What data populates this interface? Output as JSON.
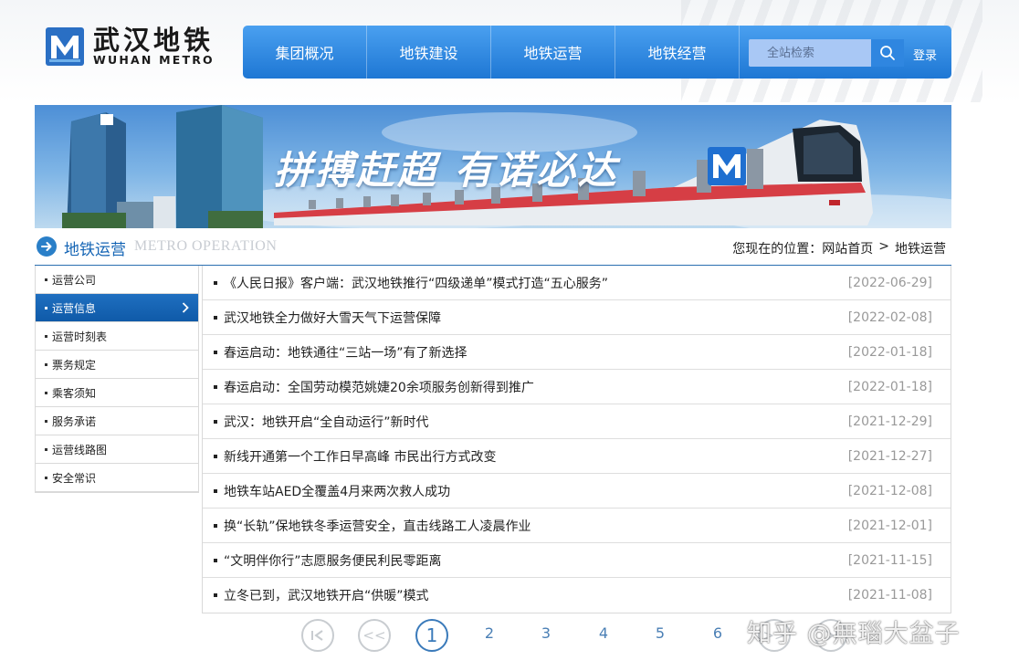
{
  "header": {
    "logo_cn": "武汉地铁",
    "logo_en": "WUHAN METRO",
    "nav": [
      "集团概况",
      "地铁建设",
      "地铁运营",
      "地铁经营"
    ],
    "search_placeholder": "全站检索",
    "login_label": "登录"
  },
  "banner": {
    "slogan": "拼搏赶超  有诺必达"
  },
  "section": {
    "title": "地铁运营",
    "subtitle": "METRO OPERATION",
    "breadcrumb_prefix": "您现在的位置：",
    "breadcrumb_home": "网站首页",
    "breadcrumb_sep": ">",
    "breadcrumb_current": "地铁运营"
  },
  "sidebar": {
    "items": [
      {
        "label": "运营公司"
      },
      {
        "label": "运营信息",
        "active": true
      },
      {
        "label": "运营时刻表"
      },
      {
        "label": "票务规定"
      },
      {
        "label": "乘客须知"
      },
      {
        "label": "服务承诺"
      },
      {
        "label": "运营线路图"
      },
      {
        "label": "安全常识"
      }
    ]
  },
  "news": [
    {
      "title": "《人民日报》客户端：武汉地铁推行“四级递单”模式打造“五心服务”",
      "date": "[2022-06-29]"
    },
    {
      "title": "武汉地铁全力做好大雪天气下运营保障",
      "date": "[2022-02-08]"
    },
    {
      "title": "春运启动：地铁通往“三站一场”有了新选择",
      "date": "[2022-01-18]"
    },
    {
      "title": "春运启动：全国劳动模范姚婕20余项服务创新得到推广",
      "date": "[2022-01-18]"
    },
    {
      "title": "武汉：地铁开启“全自动运行”新时代",
      "date": "[2021-12-29]"
    },
    {
      "title": "新线开通第一个工作日早高峰 市民出行方式改变",
      "date": "[2021-12-27]"
    },
    {
      "title": "地铁车站AED全覆盖4月来两次救人成功",
      "date": "[2021-12-08]"
    },
    {
      "title": "换“长轨”保地铁冬季运营安全，直击线路工人凌晨作业",
      "date": "[2021-12-01]"
    },
    {
      "title": "“文明伴你行”志愿服务便民利民零距离",
      "date": "[2021-11-15]"
    },
    {
      "title": "立冬已到，武汉地铁开启“供暖”模式",
      "date": "[2021-11-08]"
    }
  ],
  "pagination": {
    "first": "|<",
    "prev": "<<",
    "pages": [
      "1",
      "2",
      "3",
      "4",
      "5",
      "6"
    ],
    "current": "1",
    "next": ">>",
    "last": ">|"
  },
  "watermark": "知乎 @無瑙大盆子",
  "colors": {
    "nav_blue": "#1e77d4",
    "accent_blue": "#1565b5",
    "active_sidebar": "#0f5aa8",
    "date_gray": "#999999"
  }
}
